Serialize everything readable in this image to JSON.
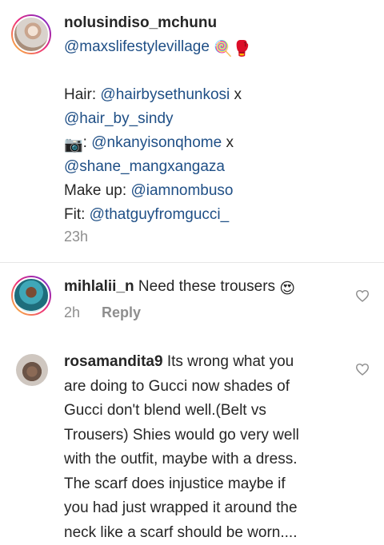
{
  "caption": {
    "username": "nolusindiso_mchunu",
    "lines": [
      {
        "mention": "@maxslifestylevillage",
        "emoji": "🍭🥊"
      },
      {
        "blank": ""
      },
      {
        "prefix": "Hair: ",
        "mention": "@hairbysethunkosi",
        "suffix": " x"
      },
      {
        "mention": "@hair_by_sindy"
      },
      {
        "camera": "📷",
        "prefix": ": ",
        "mention": "@nkanyisonqhome",
        "suffix": " x"
      },
      {
        "mention": "@shane_mangxangaza"
      },
      {
        "prefix": "Make up: ",
        "mention": "@iamnombuso"
      },
      {
        "prefix": "Fit: ",
        "mention": "@thatguyfromgucci_"
      }
    ],
    "time": "23h"
  },
  "comments": [
    {
      "username": "mihlalii_n",
      "text": "Need these trousers",
      "emoji": "😍",
      "time": "2h",
      "reply_label": "Reply"
    },
    {
      "username": "rosamandita9",
      "lines": [
        "Its wrong what you",
        "are doing to Gucci now shades of",
        "Gucci don't blend well.(Belt vs",
        "Trousers) Shies would go very well",
        "with the outfit, maybe with a dress.",
        "The scarf does injustice  maybe if",
        "you had just wrapped it around the",
        "neck like a scarf should be worn...."
      ]
    }
  ],
  "icons": {
    "like": "heart-outline-icon"
  },
  "colors": {
    "mention": "#1f4f86",
    "meta": "#8e8e8e",
    "text": "#262626"
  }
}
